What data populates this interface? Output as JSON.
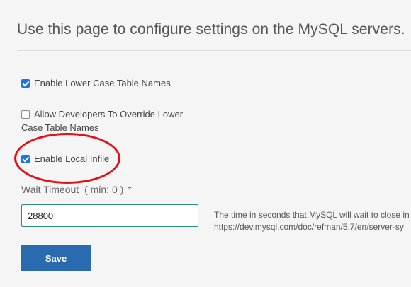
{
  "header": {
    "title": "Use this page to configure settings on the MySQL servers."
  },
  "settings": {
    "lower_case": {
      "label": "Enable Lower Case Table Names",
      "checked": true
    },
    "override": {
      "label": "Allow Developers To Override Lower Case Table Names",
      "checked": false
    },
    "local_infile": {
      "label": "Enable Local Infile",
      "checked": true
    },
    "wait_timeout": {
      "label": "Wait Timeout",
      "hint": "( min: 0 )",
      "required_marker": "*",
      "value": "28800",
      "help_line1": "The time in seconds that MySQL will wait to close in",
      "help_line2": "https://dev.mysql.com/doc/refman/5.7/en/server-sy"
    }
  },
  "actions": {
    "save_label": "Save"
  },
  "colors": {
    "accent": "#2a6aae",
    "checkbox": "#1a73e8",
    "annotation": "#e3101a"
  }
}
